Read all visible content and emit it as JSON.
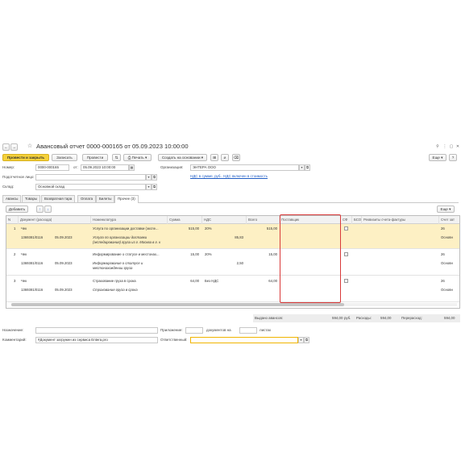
{
  "header": {
    "title": "Авансовый отчет 0000-000165 от 05.09.2023 10:00:00",
    "more_label": "Еще"
  },
  "toolbar": {
    "post_close": "Провести и закрыть",
    "save": "Записать",
    "post": "Провести",
    "print": "Печать",
    "create_based": "Создать на основании",
    "more": "Еще"
  },
  "form": {
    "number_label": "Номер:",
    "number_value": "0000-000165",
    "from_label": "от:",
    "date_value": "05.09.2023 10:00:00",
    "org_label": "Организация:",
    "org_value": "ЭНТЕРА ООО",
    "vat_link": "НДС в сумме, руб.. НДС включен в стоимость",
    "person_label": "Подотчетное лицо:",
    "person_value": "",
    "warehouse_label": "Склад:",
    "warehouse_value": "Основной склад"
  },
  "tabs": [
    "Авансы",
    "Товары",
    "Возвратная тара",
    "Оплата",
    "Билеты",
    "Прочее (3)"
  ],
  "table": {
    "add_label": "Добавить",
    "more_label": "Еще",
    "columns": [
      "N",
      "Документ (расхода)",
      "Номенклатура",
      "Сумма",
      "НДС",
      "Всего",
      "Поставщик",
      "СФ",
      "БСО",
      "Реквизиты счета-фактуры",
      "Счет зат"
    ],
    "rows": [
      {
        "n": "1",
        "doc_type": "Чек",
        "doc_num": "1369381/0116",
        "doc_date": "05.09.2023",
        "item": "Услуга по организации доставки (экспе...",
        "item_desc1": "Услуга по организации доставки",
        "item_desc2": "(экспедирования) груза из г. Москва в г. к",
        "sum": "515,00",
        "vat_rate": "20%",
        "vat_sum": "85,83",
        "total": "515,00",
        "acct1": "26",
        "acct2": "Основн"
      },
      {
        "n": "2",
        "doc_type": "Чек",
        "doc_num": "1369381/0116",
        "doc_date": "05.09.2023",
        "item": "Информирование о статусе и местонах...",
        "item_desc1": "Информирование о статусе и",
        "item_desc2": "местонахождении груза",
        "sum": "15,00",
        "vat_rate": "20%",
        "vat_sum": "2,50",
        "total": "15,00",
        "acct1": "26",
        "acct2": "Основн"
      },
      {
        "n": "3",
        "doc_type": "Чек",
        "doc_num": "1369381/0116",
        "doc_date": "05.09.2023",
        "item": "Страхование груза в срока",
        "item_desc1": "Страхование груза в срока",
        "item_desc2": "",
        "sum": "64,00",
        "vat_rate": "Без НДС",
        "vat_sum": "",
        "total": "64,00",
        "acct1": "26",
        "acct2": "Основн"
      }
    ]
  },
  "totals": {
    "issued_label": "Выдано авансов:",
    "issued_value": "",
    "spent_value": "594,00",
    "currency": "руб.",
    "expenses_label": "Расходы:",
    "expenses_value": "594,00",
    "overspend_label": "Перерасход:",
    "overspend_value": "594,00"
  },
  "footer": {
    "purpose_label": "Назначение:",
    "purpose_value": "",
    "attach_label": "Приложение:",
    "attach_value": "",
    "docs_label": "документов на",
    "sheets_value": "",
    "sheets_label": "листах",
    "comment_label": "Комментарий:",
    "comment_value": "#Документ загружен из сервиса Entera.pro",
    "resp_label": "Ответственный:",
    "resp_value": ""
  },
  "colors": {
    "primary_button": "#f5d13b",
    "selected_row": "#fdf0c4",
    "highlight_box": "#d93a3a",
    "link": "#1f5cc4"
  }
}
